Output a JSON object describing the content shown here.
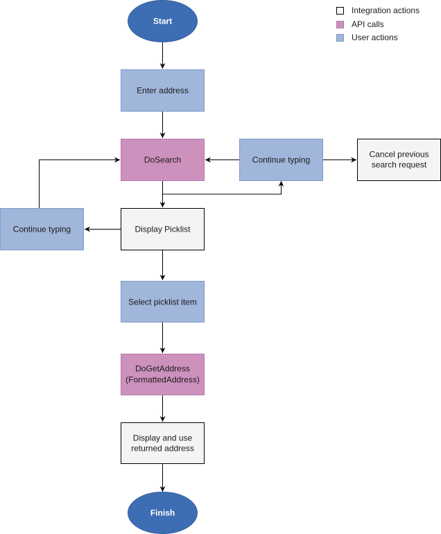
{
  "legend": [
    {
      "label": "Integration actions",
      "fill": "#f5f5f5",
      "stroke": "#000000"
    },
    {
      "label": "API calls",
      "fill": "#cd91be",
      "stroke": "#b57aa6"
    },
    {
      "label": "User actions",
      "fill": "#9fb5d9",
      "stroke": "#8099c4"
    }
  ],
  "colors": {
    "terminal": "#3d6db3",
    "user": "#a0b6da",
    "user_stroke": "#7f9bc8",
    "api": "#cd91be",
    "api_stroke": "#b47aa5",
    "integration": "#f4f4f4",
    "integration_stroke": "#000000",
    "edge": "#000000"
  },
  "nodes": {
    "start": {
      "label": "Start",
      "kind": "terminal"
    },
    "enter_address": {
      "label": "Enter address",
      "kind": "user"
    },
    "dosearch": {
      "label": "DoSearch",
      "kind": "api"
    },
    "continue_typing_right": {
      "label": "Continue typing",
      "kind": "user"
    },
    "cancel_previous": {
      "label": [
        "Cancel previous",
        "search request"
      ],
      "kind": "integration"
    },
    "continue_typing_left": {
      "label": "Continue typing",
      "kind": "user"
    },
    "display_picklist": {
      "label": "Display Picklist",
      "kind": "integration"
    },
    "select_picklist_item": {
      "label": "Select picklist item",
      "kind": "user"
    },
    "dogetaddress": {
      "label": [
        "DoGetAddress",
        "(FormattedAddress)"
      ],
      "kind": "api"
    },
    "display_use_address": {
      "label": [
        "Display and use",
        "returned address"
      ],
      "kind": "integration"
    },
    "finish": {
      "label": "Finish",
      "kind": "terminal"
    }
  },
  "edges": [
    {
      "from": "start",
      "to": "enter_address"
    },
    {
      "from": "enter_address",
      "to": "dosearch"
    },
    {
      "from": "dosearch",
      "to": "display_picklist"
    },
    {
      "from": "dosearch",
      "to": "continue_typing_right"
    },
    {
      "from": "continue_typing_right",
      "to": "dosearch"
    },
    {
      "from": "continue_typing_right",
      "to": "cancel_previous"
    },
    {
      "from": "display_picklist",
      "to": "continue_typing_left"
    },
    {
      "from": "continue_typing_left",
      "to": "dosearch"
    },
    {
      "from": "display_picklist",
      "to": "select_picklist_item"
    },
    {
      "from": "select_picklist_item",
      "to": "dogetaddress"
    },
    {
      "from": "dogetaddress",
      "to": "display_use_address"
    },
    {
      "from": "display_use_address",
      "to": "finish"
    }
  ]
}
